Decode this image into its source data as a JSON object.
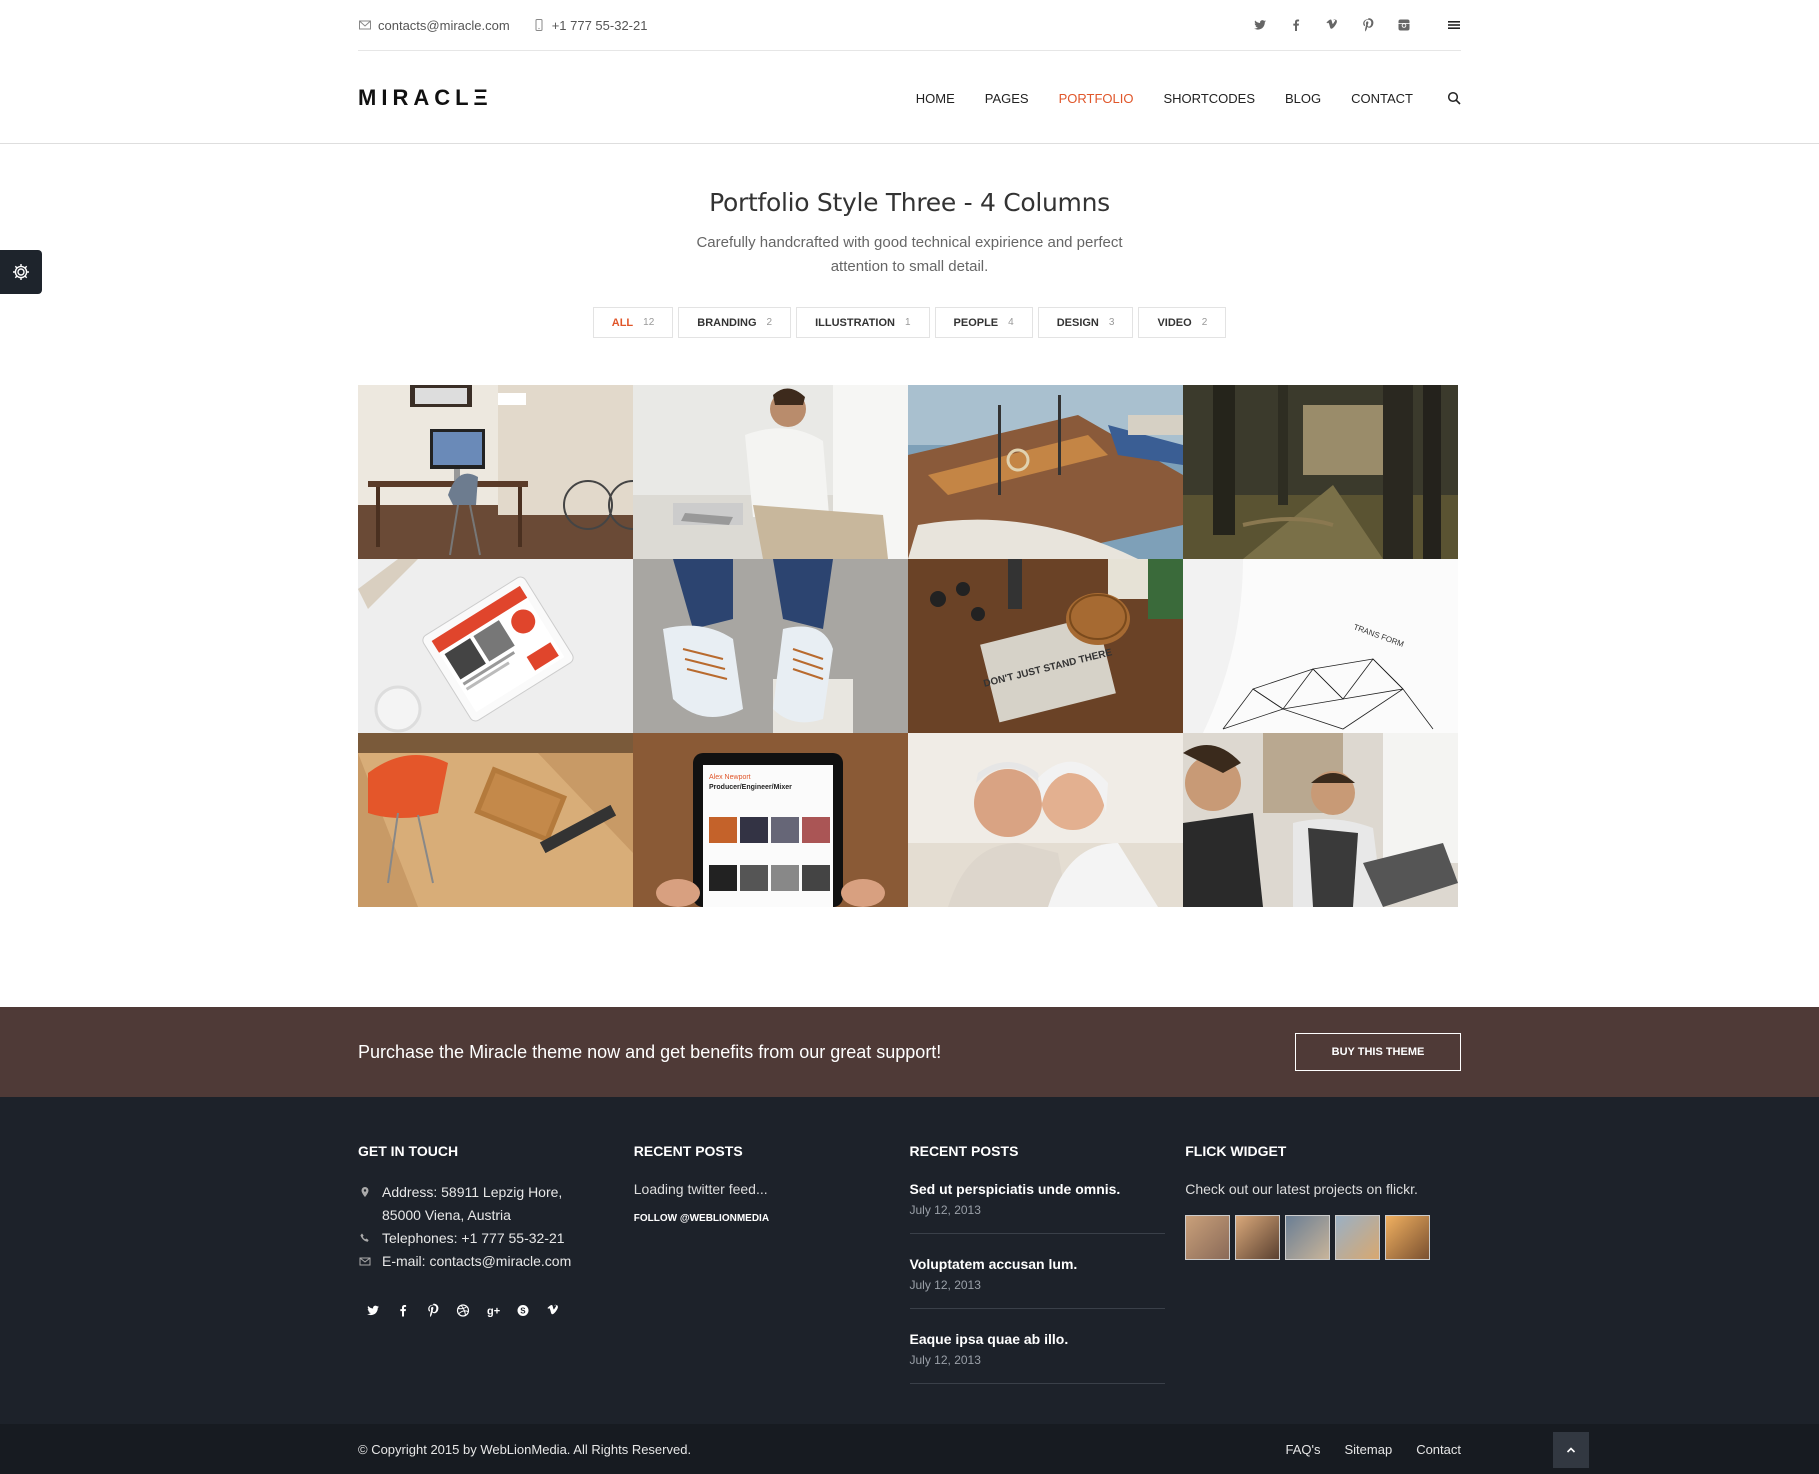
{
  "topbar": {
    "email": "contacts@miracle.com",
    "phone": "+1 777 55-32-21",
    "social_icons": [
      "twitter-icon",
      "facebook-icon",
      "vimeo-icon",
      "pinterest-icon",
      "instagram-icon"
    ]
  },
  "header": {
    "logo": "MIRACLΞ",
    "nav": [
      "HOME",
      "PAGES",
      "PORTFOLIO",
      "SHORTCODES",
      "BLOG",
      "CONTACT"
    ],
    "active_nav": "PORTFOLIO"
  },
  "page": {
    "title": "Portfolio Style Three - 4 Columns",
    "subtitle": "Carefully handcrafted with good technical expirience and perfect attention to small detail."
  },
  "filters": [
    {
      "label": "ALL",
      "count": "12"
    },
    {
      "label": "BRANDING",
      "count": "2"
    },
    {
      "label": "ILLUSTRATION",
      "count": "1"
    },
    {
      "label": "PEOPLE",
      "count": "4"
    },
    {
      "label": "DESIGN",
      "count": "3"
    },
    {
      "label": "VIDEO",
      "count": "2"
    }
  ],
  "portfolio": {
    "tablet_name": "Alex Newport",
    "tablet_role": "Producer/Engineer/Mixer",
    "book_text": "DON'T JUST STAND THERE"
  },
  "purchase": {
    "message": "Purchase the Miracle theme now and get benefits from our great support!",
    "button": "BUY THIS THEME"
  },
  "footer": {
    "contact": {
      "title": "GET IN TOUCH",
      "address_line1": "Address: 58911 Lepzig Hore,",
      "address_line2": "85000 Viena, Austria",
      "telephone": "Telephones: +1 777 55-32-21",
      "email": "E-mail: contacts@miracle.com"
    },
    "twitter": {
      "title": "RECENT POSTS",
      "loading": "Loading twitter feed...",
      "follow": "FOLLOW @WEBLIONMEDIA"
    },
    "posts": {
      "title": "RECENT POSTS",
      "items": [
        {
          "title": "Sed ut perspiciatis unde omnis.",
          "date": "July 12, 2013"
        },
        {
          "title": "Voluptatem accusan lum.",
          "date": "July 12, 2013"
        },
        {
          "title": "Eaque ipsa quae ab illo.",
          "date": "July 12, 2013"
        }
      ]
    },
    "flick": {
      "title": "FLICK WIDGET",
      "text": "Check out our latest projects on flickr."
    }
  },
  "bottom": {
    "copyright": "© Copyright 2015 by WebLionMedia. All Rights Reserved.",
    "links": [
      "FAQ's",
      "Sitemap",
      "Contact"
    ]
  },
  "colors": {
    "accent": "#e0562a",
    "purchase_bg": "#4f3a37",
    "footer_bg": "#1d222a",
    "bottom_bg": "#171b21"
  }
}
